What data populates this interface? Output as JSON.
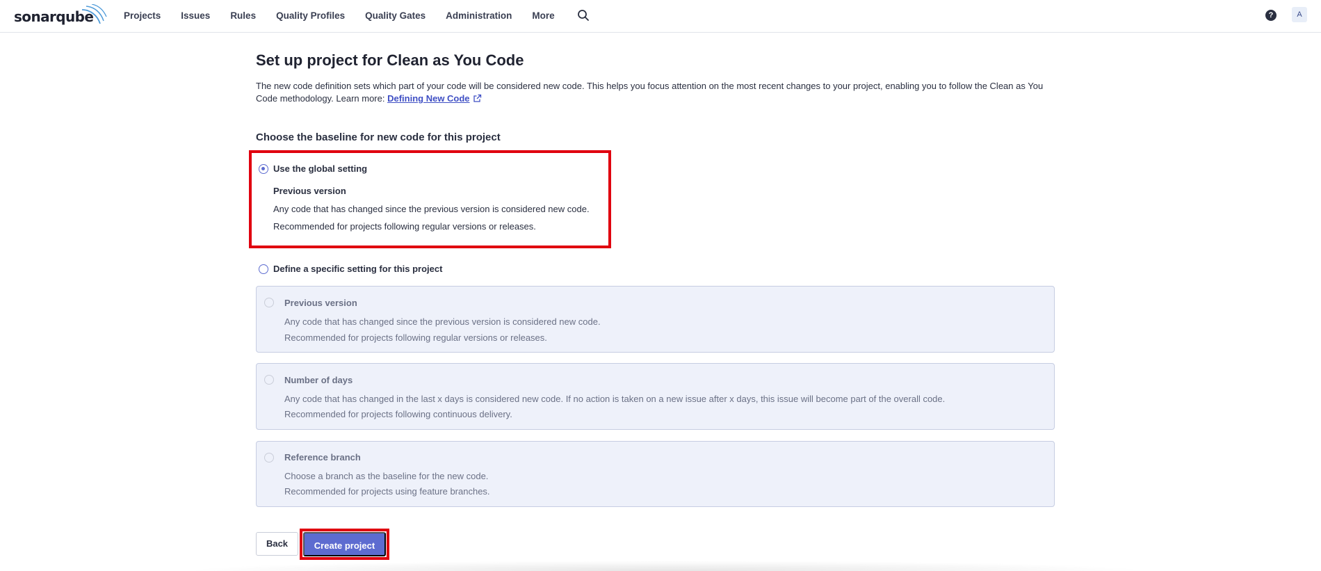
{
  "brand": {
    "logo_text": "sonarqube"
  },
  "nav": {
    "items": [
      "Projects",
      "Issues",
      "Rules",
      "Quality Profiles",
      "Quality Gates",
      "Administration",
      "More"
    ],
    "search_icon": "search-icon"
  },
  "header_right": {
    "help_label": "?",
    "avatar_initial": "A"
  },
  "page": {
    "title": "Set up project for Clean as You Code",
    "intro_text": "The new code definition sets which part of your code will be considered new code. This helps you focus attention on the most recent changes to your project, enabling you to follow the Clean as You Code methodology. Learn more: ",
    "intro_link": "Defining New Code",
    "section_title": "Choose the baseline for new code for this project"
  },
  "global_option": {
    "label": "Use the global setting",
    "checked": true,
    "setting_title": "Previous version",
    "line1": "Any code that has changed since the previous version is considered new code.",
    "line2": "Recommended for projects following regular versions or releases."
  },
  "specific_option": {
    "label": "Define a specific setting for this project",
    "checked": false,
    "cards": [
      {
        "title": "Previous version",
        "line1": "Any code that has changed since the previous version is considered new code.",
        "line2": "Recommended for projects following regular versions or releases."
      },
      {
        "title": "Number of days",
        "line1": "Any code that has changed in the last x days is considered new code. If no action is taken on a new issue after x days, this issue will become part of the overall code.",
        "line2": "Recommended for projects following continuous delivery."
      },
      {
        "title": "Reference branch",
        "line1": "Choose a branch as the baseline for the new code.",
        "line2": "Recommended for projects using feature branches."
      }
    ]
  },
  "actions": {
    "back_label": "Back",
    "create_label": "Create project"
  },
  "colors": {
    "accent": "#5d6cd0",
    "highlight": "#e0000f",
    "card_bg": "#eef1fa",
    "link": "#3f4fc4"
  }
}
